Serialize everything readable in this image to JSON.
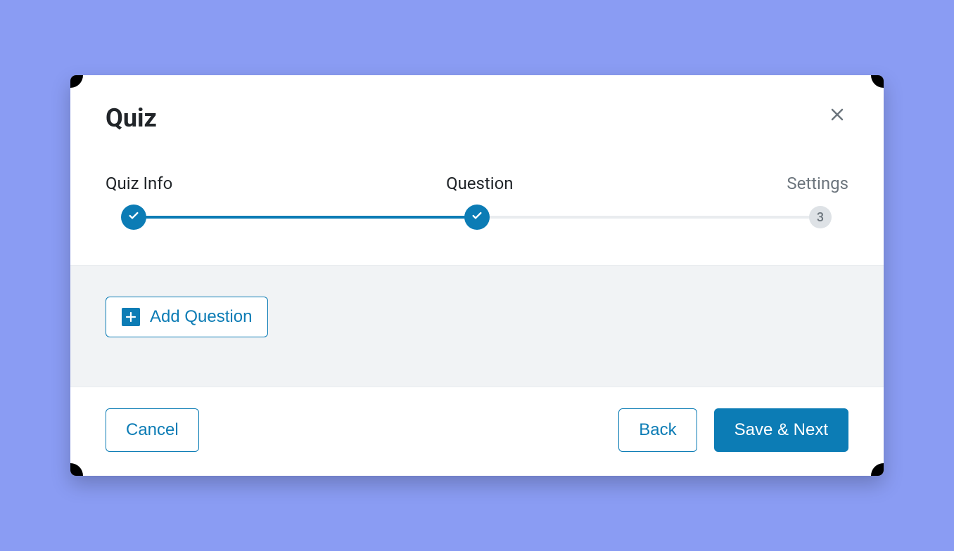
{
  "modal": {
    "title": "Quiz"
  },
  "stepper": {
    "steps": [
      {
        "label": "Quiz Info",
        "state": "done"
      },
      {
        "label": "Question",
        "state": "done"
      },
      {
        "label": "Settings",
        "state": "pending",
        "number": "3"
      }
    ]
  },
  "body": {
    "add_question_label": "Add Question"
  },
  "footer": {
    "cancel_label": "Cancel",
    "back_label": "Back",
    "save_next_label": "Save & Next"
  },
  "colors": {
    "primary": "#0c7cb5",
    "background": "#8a9cf3",
    "muted": "#6c757d"
  }
}
